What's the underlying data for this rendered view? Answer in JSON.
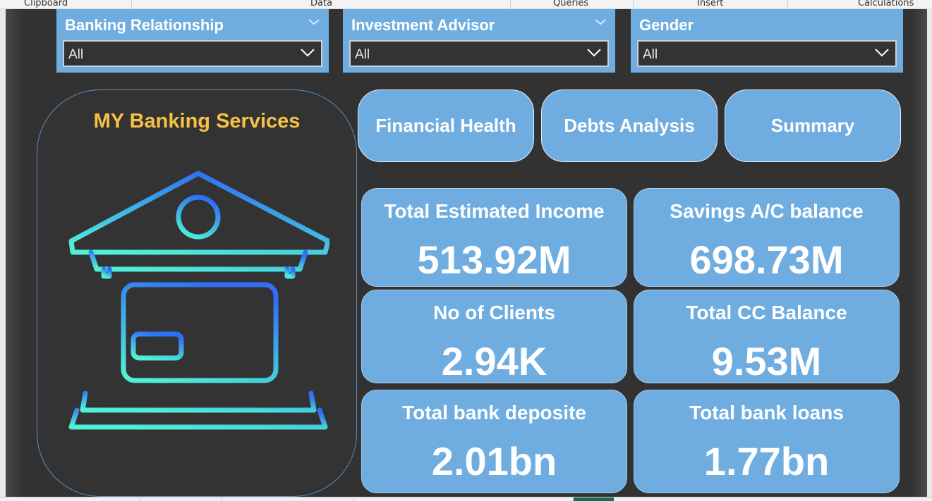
{
  "ribbon": {
    "groups": [
      "Clipboard",
      "Data",
      "Queries",
      "Insert",
      "Calculations"
    ]
  },
  "slicers": [
    {
      "title": "Banking Relationship",
      "value": "All"
    },
    {
      "title": "Investment Advisor",
      "value": "All"
    },
    {
      "title": "Gender",
      "value": "All"
    }
  ],
  "logo": {
    "title": "MY Banking Services",
    "icon": "bank-building-card-icon",
    "gradient_top": "#2f6ef5",
    "gradient_bottom": "#4ff0d6"
  },
  "nav": {
    "financial_health": "Financial Health",
    "debts_analysis": "Debts Analysis",
    "summary": "Summary"
  },
  "kpis": [
    {
      "label": "Total Estimated Income",
      "value": "513.92M"
    },
    {
      "label": "Savings A/C balance",
      "value": "698.73M"
    },
    {
      "label": "No of Clients",
      "value": "2.94K"
    },
    {
      "label": "Total CC Balance",
      "value": "9.53M"
    },
    {
      "label": "Total bank deposite",
      "value": "2.01bn"
    },
    {
      "label": "Total bank loans",
      "value": "1.77bn"
    }
  ],
  "colors": {
    "accent": "#6fade0",
    "title_gold": "#f7c242",
    "canvas": "#323232"
  }
}
